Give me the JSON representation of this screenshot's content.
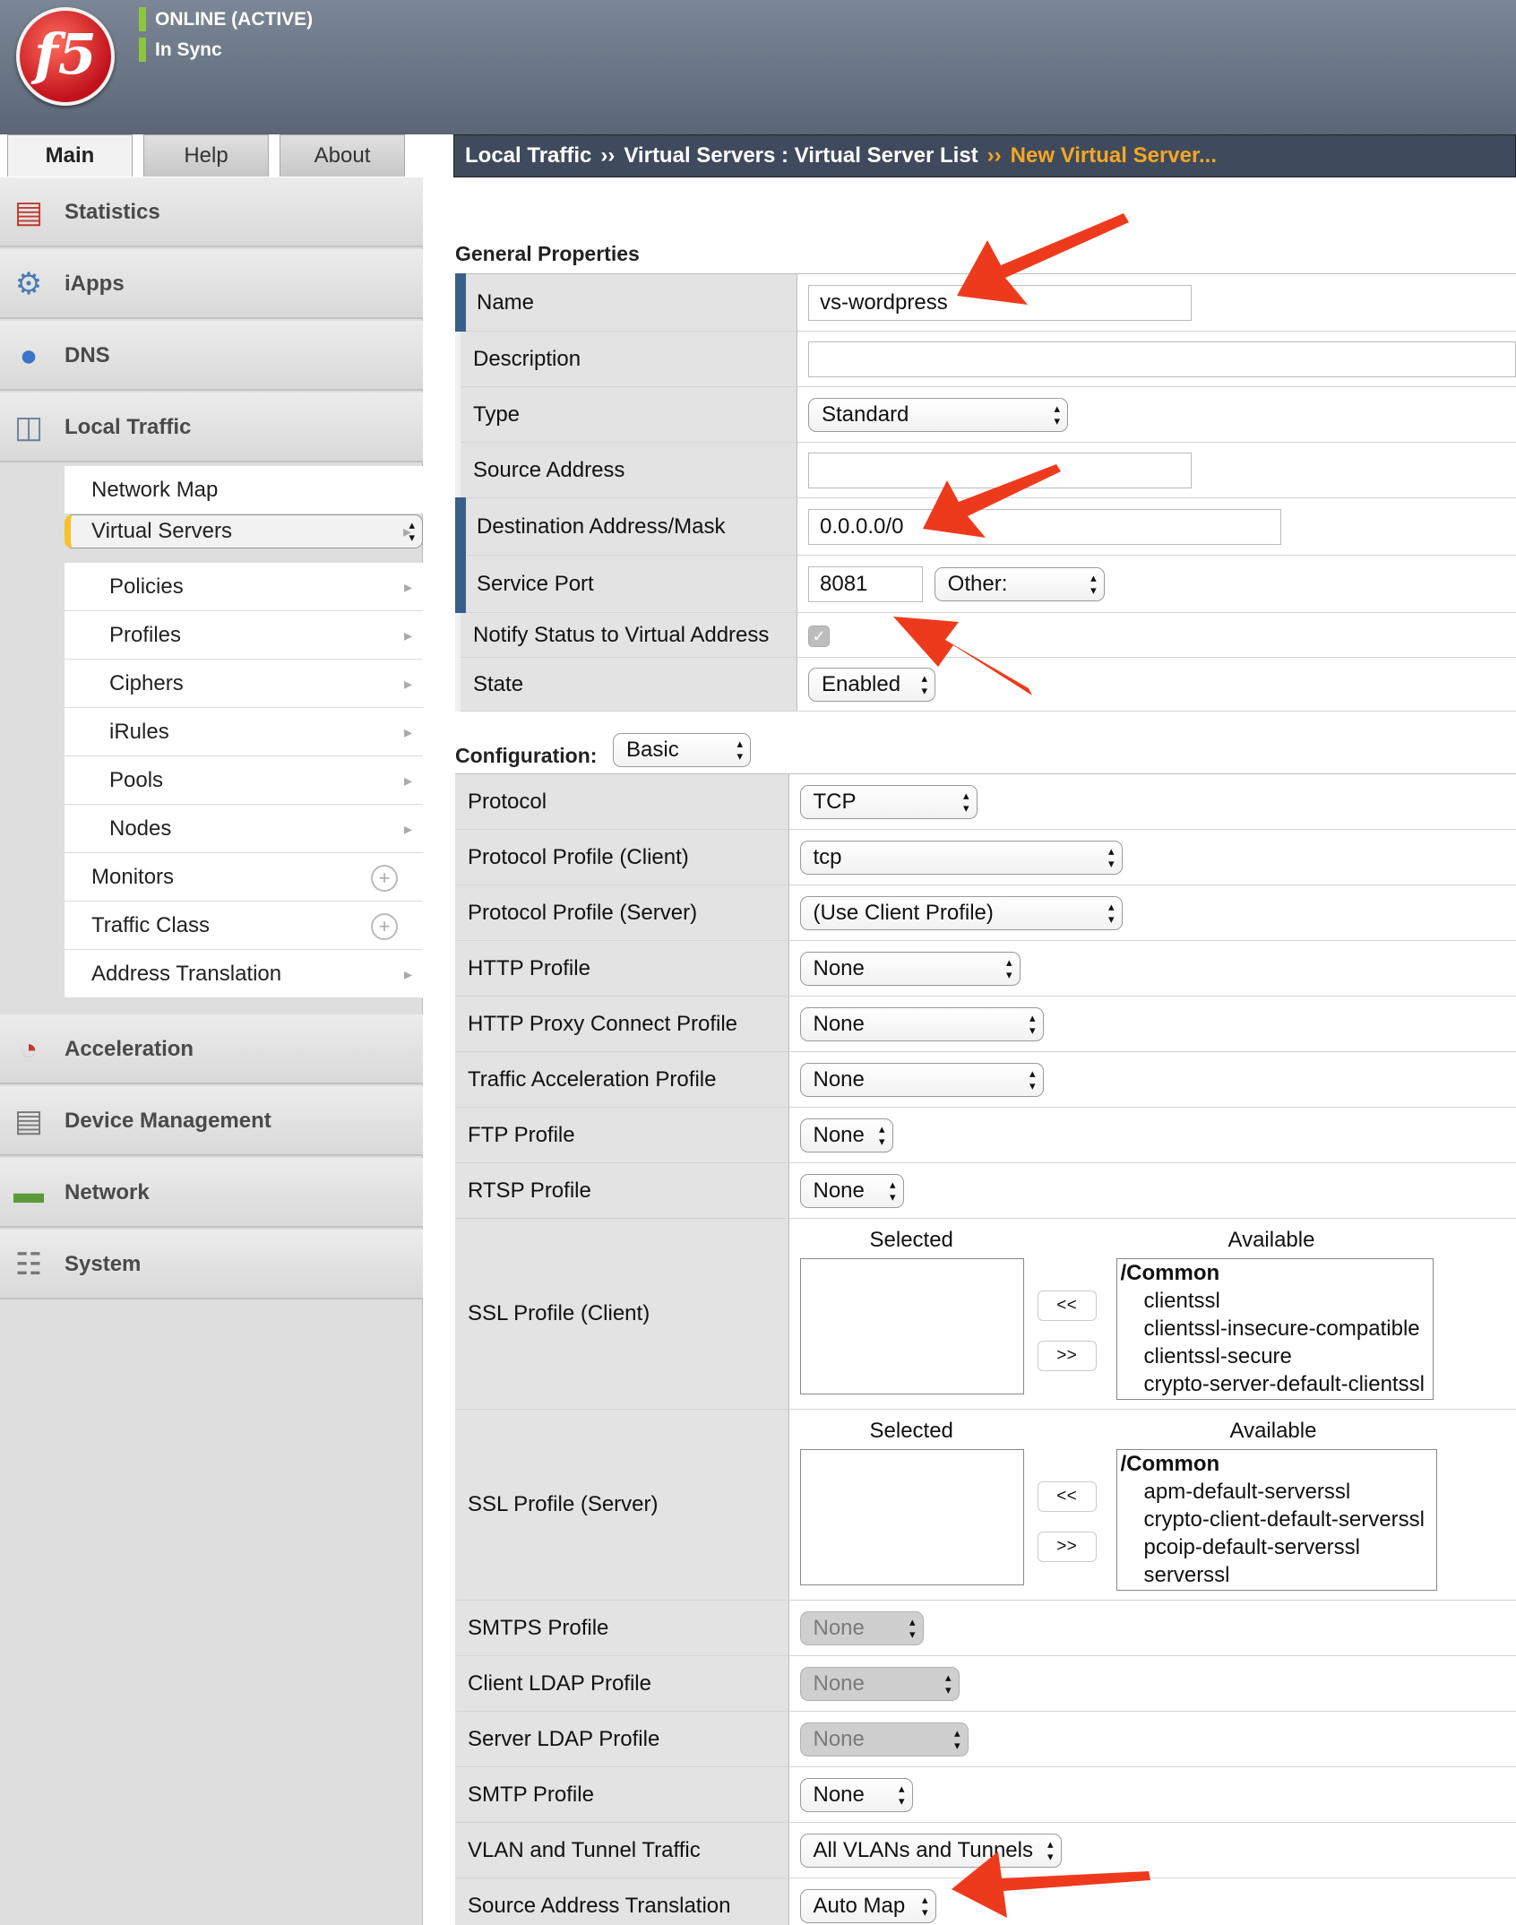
{
  "header": {
    "status_online": "ONLINE (ACTIVE)",
    "status_sync": "In Sync",
    "logo_text": "f5"
  },
  "tabs": [
    "Main",
    "Help",
    "About"
  ],
  "breadcrumb": {
    "part1": "Local Traffic",
    "part2": "Virtual Servers : Virtual Server List",
    "current": "New Virtual Server...",
    "sep": "››"
  },
  "sidebar": {
    "sections": [
      "Statistics",
      "iApps",
      "DNS",
      "Local Traffic"
    ],
    "lt_items": [
      "Network Map",
      "Virtual Servers",
      "Policies",
      "Profiles",
      "Ciphers",
      "iRules",
      "Pools",
      "Nodes",
      "Monitors",
      "Traffic Class",
      "Address Translation"
    ],
    "bottom_sections": [
      "Acceleration",
      "Device Management",
      "Network",
      "System"
    ]
  },
  "general": {
    "heading": "General Properties",
    "name_label": "Name",
    "name_value": "vs-wordpress",
    "description_label": "Description",
    "description_value": "",
    "type_label": "Type",
    "type_value": "Standard",
    "source_label": "Source Address",
    "source_value": "",
    "dest_label": "Destination Address/Mask",
    "dest_value": "0.0.0.0/0",
    "port_label": "Service Port",
    "port_value": "8081",
    "port_select": "Other:",
    "notify_label": "Notify Status to Virtual Address",
    "notify_checked": true,
    "state_label": "State",
    "state_value": "Enabled"
  },
  "config": {
    "heading": "Configuration:",
    "mode": "Basic",
    "rows": [
      {
        "label": "Protocol",
        "value": "TCP"
      },
      {
        "label": "Protocol Profile (Client)",
        "value": "tcp"
      },
      {
        "label": "Protocol Profile (Server)",
        "value": "(Use Client Profile)"
      },
      {
        "label": "HTTP Profile",
        "value": "None"
      },
      {
        "label": "HTTP Proxy Connect Profile",
        "value": "None"
      },
      {
        "label": "Traffic Acceleration Profile",
        "value": "None"
      },
      {
        "label": "FTP Profile",
        "value": "None"
      },
      {
        "label": "RTSP Profile",
        "value": "None"
      }
    ],
    "ssl_client": {
      "label": "SSL Profile (Client)",
      "selected_hdr": "Selected",
      "available_hdr": "Available",
      "group": "/Common",
      "options": [
        "clientssl",
        "clientssl-insecure-compatible",
        "clientssl-secure",
        "crypto-server-default-clientssl"
      ]
    },
    "ssl_server": {
      "label": "SSL Profile (Server)",
      "selected_hdr": "Selected",
      "available_hdr": "Available",
      "group": "/Common",
      "options": [
        "apm-default-serverssl",
        "crypto-client-default-serverssl",
        "pcoip-default-serverssl",
        "serverssl"
      ]
    },
    "btn_left": "<<",
    "btn_right": ">>",
    "rows2": [
      {
        "label": "SMTPS Profile",
        "value": "None"
      },
      {
        "label": "Client LDAP Profile",
        "value": "None"
      },
      {
        "label": "Server LDAP Profile",
        "value": "None"
      },
      {
        "label": "SMTP Profile",
        "value": "None"
      },
      {
        "label": "VLAN and Tunnel Traffic",
        "value": "All VLANs and Tunnels"
      },
      {
        "label": "Source Address Translation",
        "value": "Auto Map"
      }
    ]
  },
  "colors": {
    "accent": "#3a5e8c",
    "annotation": "#ee3a1c",
    "online": "#8cc63f",
    "crumb_current": "#f6a623"
  }
}
